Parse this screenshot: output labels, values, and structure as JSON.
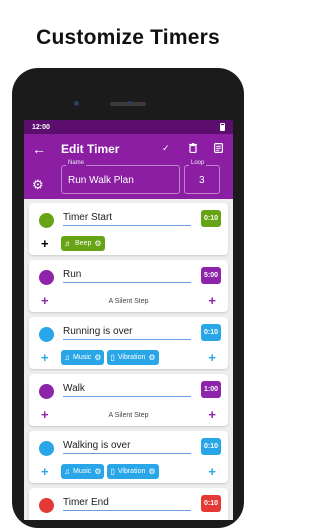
{
  "headline": "Customize Timers",
  "status_bar": {
    "time": "12:00"
  },
  "app_bar": {
    "title": "Edit Timer",
    "name_label": "Name",
    "name_value": "Run Walk Plan",
    "loop_label": "Loop",
    "loop_value": "3"
  },
  "steps": [
    {
      "name": "Timer Start",
      "duration": "0:10",
      "color": "#66a315",
      "chips": [
        {
          "label": "Beep",
          "icon": "bell-icon",
          "color": "#66a315"
        }
      ]
    },
    {
      "name": "Run",
      "duration": "5:00",
      "color": "#8e24aa",
      "silent": "A Silent Step"
    },
    {
      "name": "Running is over",
      "duration": "0:10",
      "color": "#29a6e8",
      "chips": [
        {
          "label": "Music",
          "icon": "music-note-icon",
          "color": "#29a6e8"
        },
        {
          "label": "Vibration",
          "icon": "vibration-icon",
          "color": "#29a6e8"
        }
      ]
    },
    {
      "name": "Walk",
      "duration": "1:00",
      "color": "#8e24aa",
      "silent": "A Silent Step"
    },
    {
      "name": "Walking is over",
      "duration": "0:10",
      "color": "#29a6e8",
      "chips": [
        {
          "label": "Music",
          "icon": "music-note-icon",
          "color": "#29a6e8"
        },
        {
          "label": "Vibration",
          "icon": "vibration-icon",
          "color": "#29a6e8"
        }
      ]
    },
    {
      "name": "Timer End",
      "duration": "0:10",
      "color": "#e53935"
    }
  ],
  "colors": {
    "app_bar": "#8b1ea3",
    "status_bar": "#5c0e6e",
    "add_step": "#8e24aa"
  }
}
